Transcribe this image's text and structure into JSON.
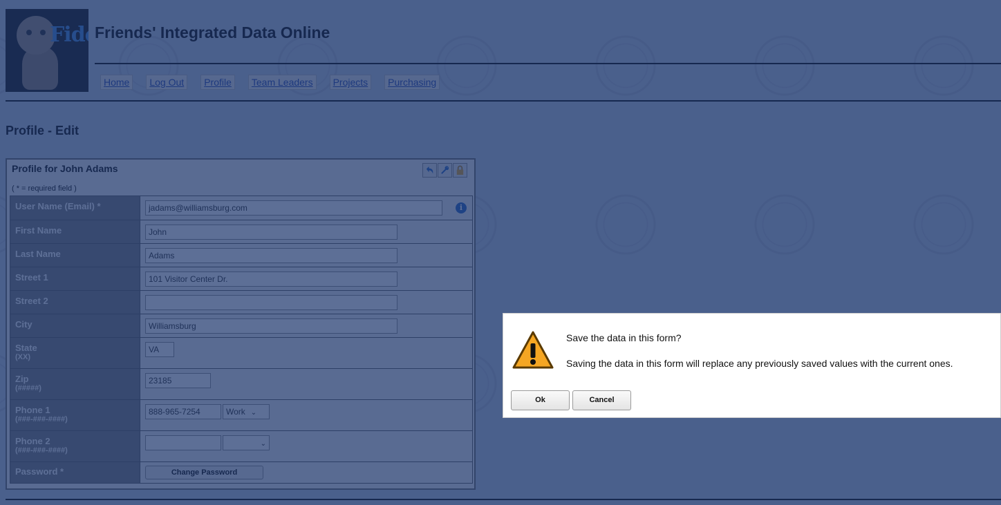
{
  "app": {
    "title": "Friends' Integrated Data Online",
    "logo_text": "Fido"
  },
  "nav": {
    "items": [
      {
        "label": "Home"
      },
      {
        "label": "Log Out"
      },
      {
        "label": "Profile"
      },
      {
        "label": "Team Leaders"
      },
      {
        "label": "Projects"
      },
      {
        "label": "Purchasing"
      }
    ]
  },
  "page": {
    "title": "Profile - Edit"
  },
  "panel": {
    "title": "Profile for John Adams",
    "required_note": "( * = required field )",
    "icons": [
      "undo-icon",
      "tools-icon",
      "lock-icon"
    ]
  },
  "form": {
    "username": {
      "label": "User Name (Email) *",
      "value": "jadams@williamsburg.com"
    },
    "first_name": {
      "label": "First Name",
      "value": "John"
    },
    "last_name": {
      "label": "Last Name",
      "value": "Adams"
    },
    "street1": {
      "label": "Street 1",
      "value": "101 Visitor Center Dr."
    },
    "street2": {
      "label": "Street 2",
      "value": ""
    },
    "city": {
      "label": "City",
      "value": "Williamsburg"
    },
    "state": {
      "label": "State",
      "hint": "(XX)",
      "value": "VA"
    },
    "zip": {
      "label": "Zip",
      "hint": "(#####)",
      "value": "23185"
    },
    "phone1": {
      "label": "Phone 1",
      "hint": "(###-###-####)",
      "value": "888-965-7254",
      "type": "Work"
    },
    "phone2": {
      "label": "Phone 2",
      "hint": "(###-###-####)",
      "value": "",
      "type": ""
    },
    "password": {
      "label": "Password *",
      "button": "Change Password"
    }
  },
  "dialog": {
    "title": "Save the data in this form?",
    "message": "Saving the data in this form will replace any previously saved values with the current ones.",
    "ok": "Ok",
    "cancel": "Cancel"
  },
  "colors": {
    "overlay": "#1e376e",
    "link": "#1a3fa8",
    "label_bg": "#777777",
    "info_icon": "#1f5fbf",
    "warning_icon": "#f5a623"
  }
}
